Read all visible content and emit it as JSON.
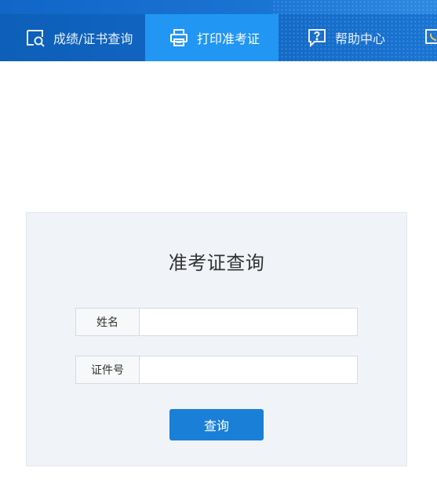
{
  "nav": {
    "items": [
      {
        "label": "成绩/证书查询",
        "icon": "search-certificate-icon",
        "active": false
      },
      {
        "label": "打印准考证",
        "icon": "printer-icon",
        "active": true
      },
      {
        "label": "帮助中心",
        "icon": "help-chat-icon",
        "active": false
      },
      {
        "label": "",
        "icon": "phone-icon",
        "active": false
      }
    ]
  },
  "form": {
    "title": "准考证查询",
    "name_label": "姓名",
    "name_value": "",
    "id_label": "证件号",
    "id_value": "",
    "submit_label": "查询"
  },
  "colors": {
    "nav_bg": "#1267c4",
    "nav_active": "#2196f3",
    "button": "#1a7fd6",
    "panel_bg": "#f0f3f7"
  }
}
